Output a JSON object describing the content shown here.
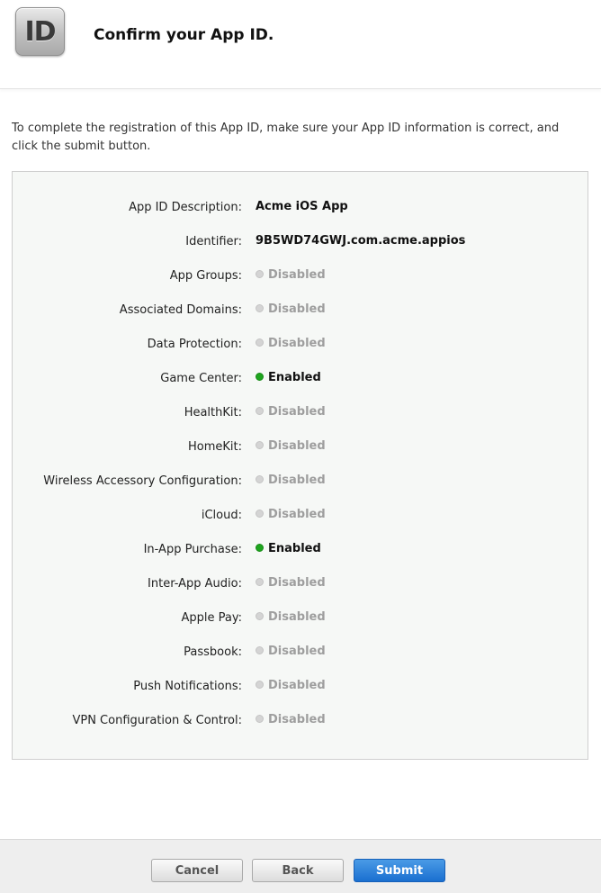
{
  "header": {
    "icon_text": "ID",
    "title": "Confirm your App ID."
  },
  "intro": "To complete the registration of this App ID, make sure your App ID information is correct, and click the submit button.",
  "details": [
    {
      "label": "App ID Description:",
      "value": "Acme iOS App",
      "status": "text"
    },
    {
      "label": "Identifier:",
      "value": "9B5WD74GWJ.com.acme.appios",
      "status": "text"
    },
    {
      "label": "App Groups:",
      "value": "Disabled",
      "status": "disabled"
    },
    {
      "label": "Associated Domains:",
      "value": "Disabled",
      "status": "disabled"
    },
    {
      "label": "Data Protection:",
      "value": "Disabled",
      "status": "disabled"
    },
    {
      "label": "Game Center:",
      "value": "Enabled",
      "status": "enabled"
    },
    {
      "label": "HealthKit:",
      "value": "Disabled",
      "status": "disabled"
    },
    {
      "label": "HomeKit:",
      "value": "Disabled",
      "status": "disabled"
    },
    {
      "label": "Wireless Accessory Configuration:",
      "value": "Disabled",
      "status": "disabled"
    },
    {
      "label": "iCloud:",
      "value": "Disabled",
      "status": "disabled"
    },
    {
      "label": "In-App Purchase:",
      "value": "Enabled",
      "status": "enabled"
    },
    {
      "label": "Inter-App Audio:",
      "value": "Disabled",
      "status": "disabled"
    },
    {
      "label": "Apple Pay:",
      "value": "Disabled",
      "status": "disabled"
    },
    {
      "label": "Passbook:",
      "value": "Disabled",
      "status": "disabled"
    },
    {
      "label": "Push Notifications:",
      "value": "Disabled",
      "status": "disabled"
    },
    {
      "label": "VPN Configuration & Control:",
      "value": "Disabled",
      "status": "disabled"
    }
  ],
  "footer": {
    "cancel_label": "Cancel",
    "back_label": "Back",
    "submit_label": "Submit"
  },
  "colors": {
    "enabled_dot": "#1ea51e",
    "disabled_dot": "#d4d4d4",
    "submit_button": "#1a6fd0",
    "panel_background": "#f6f8f6"
  }
}
